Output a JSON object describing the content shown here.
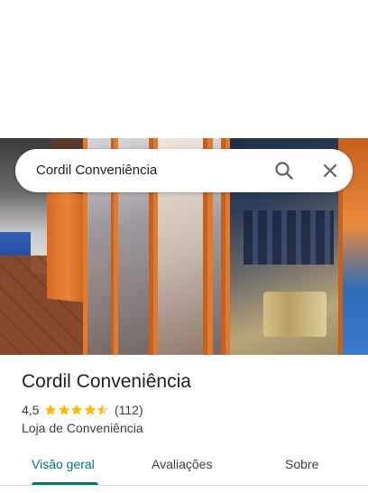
{
  "search": {
    "query": "Cordil Conveniência"
  },
  "place": {
    "name": "Cordil Conveniência",
    "rating": "4,5",
    "rating_stars": 4.5,
    "review_count": "(112)",
    "category": "Loja de Conveniência"
  },
  "tabs": [
    {
      "label": "Visão geral",
      "active": true
    },
    {
      "label": "Avaliações",
      "active": false
    },
    {
      "label": "Sobre",
      "active": false
    }
  ],
  "colors": {
    "accent": "#00796b",
    "star": "#fbbc04",
    "star_empty": "#dadce0"
  },
  "icons": {
    "search": "search-icon",
    "close": "close-icon",
    "star": "star-icon"
  }
}
